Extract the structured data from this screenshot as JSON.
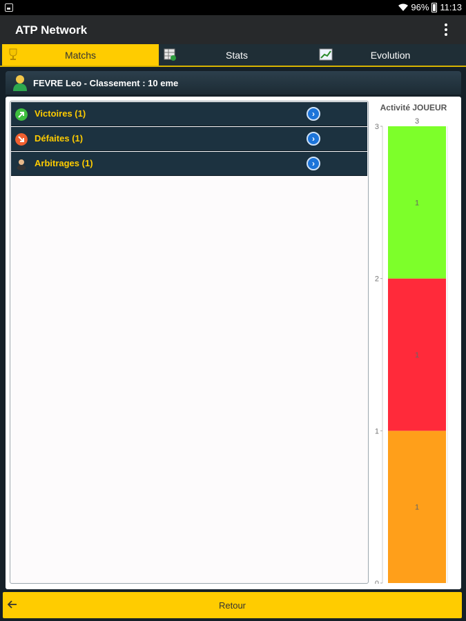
{
  "status": {
    "battery": "96%",
    "time": "11:13"
  },
  "app": {
    "title": "ATP Network"
  },
  "tabs": [
    {
      "label": "Matchs",
      "icon": "trophy-icon"
    },
    {
      "label": "Stats",
      "icon": "stats-table-icon"
    },
    {
      "label": "Evolution",
      "icon": "chart-icon"
    }
  ],
  "player": {
    "header": "FEVRE Leo - Classement : 10 eme"
  },
  "rows": [
    {
      "label": "Victoires (1)",
      "icon": "victory-arrow-icon"
    },
    {
      "label": "Défaites (1)",
      "icon": "defeat-arrow-icon"
    },
    {
      "label": "Arbitrages (1)",
      "icon": "referee-icon"
    }
  ],
  "chart_data": {
    "type": "bar",
    "title": "Activité JOUEUR",
    "stacked": true,
    "categories": [
      ""
    ],
    "total": 3,
    "series": [
      {
        "name": "Arbitrages",
        "values": [
          1
        ],
        "color": "#ff9f1a"
      },
      {
        "name": "Défaites",
        "values": [
          1
        ],
        "color": "#ff2a3a"
      },
      {
        "name": "Victoires",
        "values": [
          1
        ],
        "color": "#7dff2a"
      }
    ],
    "ylim": [
      0,
      3
    ],
    "yticks": [
      "0",
      "1",
      "2",
      "3"
    ]
  },
  "footer": {
    "back_label": "Retour"
  }
}
